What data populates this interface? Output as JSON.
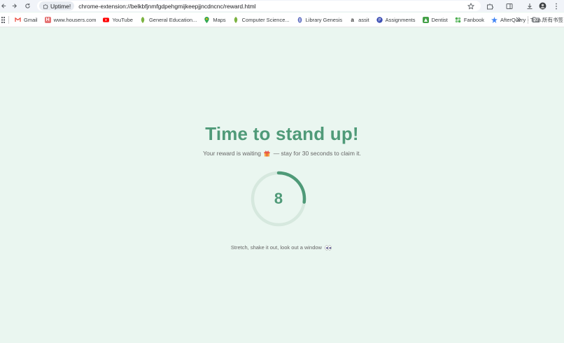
{
  "browser": {
    "tab_chip_label": "Uptime!",
    "url": "chrome-extension://belkbfjnmfgdpehgmijkeepjjncdncnc/reward.html"
  },
  "bookmarks": [
    {
      "label": "Gmail",
      "icon": "gmail-icon",
      "color": "#ea4335"
    },
    {
      "label": "www.housers.com",
      "icon": "housers-icon",
      "color": "#e57373"
    },
    {
      "label": "YouTube",
      "icon": "youtube-icon",
      "color": "#ff0000"
    },
    {
      "label": "General Education...",
      "icon": "leaf-icon",
      "color": "#7cb342"
    },
    {
      "label": "Maps",
      "icon": "maps-pin-icon",
      "color": "#34a853"
    },
    {
      "label": "Computer Science...",
      "icon": "leaf-icon",
      "color": "#7cb342"
    },
    {
      "label": "Library Genesis",
      "icon": "library-icon",
      "color": "#5c6bc0"
    },
    {
      "label": "assit",
      "icon": "assistant-icon",
      "color": "#333333"
    },
    {
      "label": "Assignments",
      "icon": "assignments-icon",
      "color": "#3f51b5"
    },
    {
      "label": "Dentist",
      "icon": "dentist-icon",
      "color": "#43a047"
    },
    {
      "label": "Fanbook",
      "icon": "fanbook-icon",
      "color": "#4caf50"
    },
    {
      "label": "AfterQuery - Tran...",
      "icon": "afterquery-icon",
      "color": "#4285f4"
    }
  ],
  "all_bookmarks_label": "所有书签",
  "reward": {
    "title": "Time to stand up!",
    "subtitle_before": "Your reward is waiting",
    "subtitle_after": "— stay for 30 seconds to claim it.",
    "countdown": "8",
    "progress_fraction": 0.27,
    "footer": "Stretch, shake it out, look out a window"
  },
  "colors": {
    "accent": "#4f9a78",
    "background": "#eaf6f0",
    "ring_track": "#d6e8de"
  }
}
